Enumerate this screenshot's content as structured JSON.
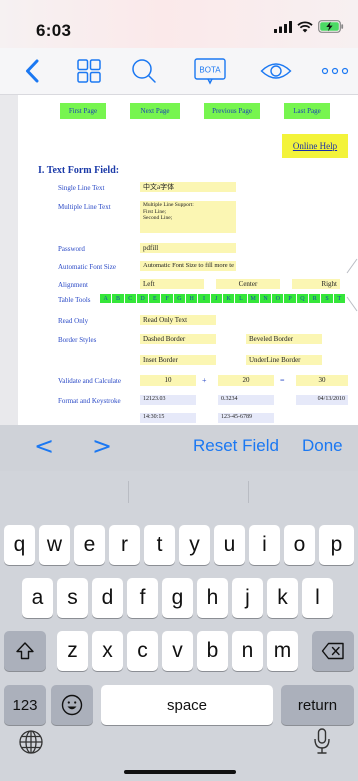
{
  "status": {
    "time": "6:03"
  },
  "toolbar": {
    "back_icon": "chevron-left-icon",
    "thumbnails_icon": "grid-icon",
    "search_icon": "search-icon",
    "bota_label": "BOTA",
    "view_icon": "eye-icon",
    "more_icon": "more-icon"
  },
  "document": {
    "nav": {
      "first": "First Page",
      "next": "Next Page",
      "previous": "Previous Page",
      "last": "Last Page"
    },
    "online_help": "Online Help",
    "section_title": "I. Text Form Field:",
    "labels": {
      "single_line": "Single Line Text",
      "multiple_line": "Multiple Line Text",
      "password": "Password",
      "auto_font": "Automatic Font Size",
      "alignment": "Alignment",
      "table_tools": "Table Tools",
      "read_only": "Read Only",
      "border_styles": "Border Styles",
      "validate": "Validate and Calculate",
      "format": "Format and Keystroke"
    },
    "fields": {
      "single_line_value": "中文a字体",
      "multi_line_1": "Multiple Line Support:",
      "multi_line_2": "First Line;",
      "multi_line_3": "Second Line;",
      "password_value": "pdfill",
      "auto_font_value": "Automatic Font Size to fill more te",
      "align_left": "Left",
      "align_center": "Center",
      "align_right": "Right",
      "read_only_value": "Read Only Text",
      "dashed_border": "Dashed Border",
      "beveled_border": "Beveled Border",
      "inset_border": "Inset Border",
      "underline_border": "UnderLine Border",
      "calc_a": "10",
      "calc_op": "+",
      "calc_b": "20",
      "calc_eq": "=",
      "calc_result": "30",
      "fmt_number": "12123.03",
      "fmt_percent": "0.3234",
      "fmt_date": "04/13/2010",
      "fmt_time": "14:30:15",
      "fmt_ssn": "123-45-6789"
    },
    "alphabet": [
      "A",
      "B",
      "C",
      "D",
      "E",
      "F",
      "G",
      "H",
      "I",
      "J",
      "K",
      "L",
      "M",
      "N",
      "O",
      "P",
      "Q",
      "R",
      "S",
      "T"
    ]
  },
  "accessory": {
    "prev": "<",
    "next": ">",
    "reset": "Reset Field",
    "done": "Done"
  },
  "keyboard": {
    "row1": [
      "q",
      "w",
      "e",
      "r",
      "t",
      "y",
      "u",
      "i",
      "o",
      "p"
    ],
    "row2": [
      "a",
      "s",
      "d",
      "f",
      "g",
      "h",
      "j",
      "k",
      "l"
    ],
    "row3": [
      "z",
      "x",
      "c",
      "v",
      "b",
      "n",
      "m"
    ],
    "numbers": "123",
    "space": "space",
    "return": "return",
    "shift_icon": "shift-icon",
    "delete_icon": "delete-icon",
    "emoji_icon": "emoji-icon",
    "globe_icon": "globe-icon",
    "mic_icon": "microphone-icon"
  },
  "colors": {
    "accent": "#1b78f2",
    "field_yellow": "#fbf6b3",
    "nav_green": "#77f54f",
    "link_blue": "#2a49c6"
  }
}
